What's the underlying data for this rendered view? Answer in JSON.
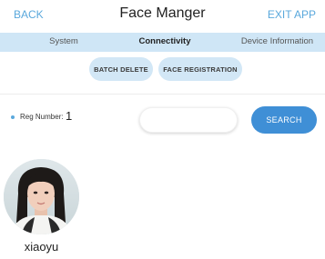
{
  "header": {
    "back_label": "BACK",
    "title": "Face Manger",
    "exit_label": "EXIT APP"
  },
  "tabs": [
    {
      "label": "System"
    },
    {
      "label": "Connectivity",
      "active": true
    },
    {
      "label": "Device Information"
    }
  ],
  "actions": {
    "batch_delete_label": "BATCH DELETE",
    "face_registration_label": "FACE REGISTRATION"
  },
  "registration": {
    "reg_number_label": "Reg Number:",
    "reg_number_value": "1"
  },
  "search": {
    "value": "",
    "button_label": "SEARCH"
  },
  "faces": [
    {
      "name": "xiaoyu",
      "avatar_icon": "person-photo-icon"
    }
  ],
  "colors": {
    "accent": "#5aa8dc",
    "tab_bar": "#cfe6f6",
    "pill": "#d2e7f6",
    "search_button": "#3f8fd6"
  }
}
